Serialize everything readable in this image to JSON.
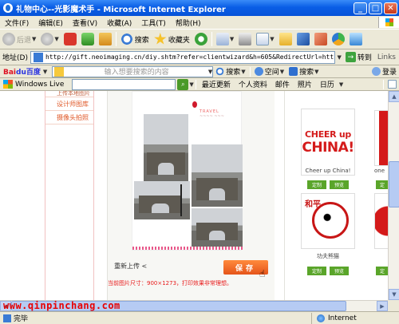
{
  "window": {
    "title": "礼物中心--光影魔术手 - Microsoft Internet Explorer",
    "minimize": "_",
    "maximize": "□",
    "close": "✕"
  },
  "menu": {
    "items": [
      "文件(F)",
      "编辑(E)",
      "查看(V)",
      "收藏(A)",
      "工具(T)",
      "帮助(H)"
    ]
  },
  "toolbar": {
    "back": "后退",
    "search": "搜索",
    "favorites": "收藏夹"
  },
  "address": {
    "label": "地址(D)",
    "url": "http://gift.neoimaging.cn/diy.shtm?refer=clientwizard&h=605&RedirectUrl=htt",
    "go": "转到",
    "links": "Links"
  },
  "baidu": {
    "logo_a": "Bai",
    "logo_b": "du百度",
    "placeholder": "输入想要搜索的内容",
    "search": "搜索",
    "space": "空间",
    "search2": "搜索",
    "login": "登录"
  },
  "live": {
    "logo": "Windows Live",
    "items": [
      "最近更新",
      "个人资料",
      "邮件",
      "照片",
      "日历"
    ]
  },
  "page": {
    "nav": [
      "上传本地图片",
      "设计师图库",
      "摄像头拍照"
    ],
    "card_text": "TRAVEL",
    "card_sub": "~~~~ ~~~",
    "reupload": "重新上传",
    "save": "保存",
    "size_info": "当前图片尺寸：900×1273，打印效果非常理想。",
    "designs": [
      {
        "line1": "CHEER up",
        "line2": "CHINA!",
        "caption": "Cheer up China!",
        "btn1": "定制",
        "btn2": "预览"
      },
      {
        "chars": "和平",
        "caption": "功夫熊猫",
        "btn1": "定制",
        "btn2": "预览"
      }
    ],
    "partial_caption": "one",
    "partial_btn": "定"
  },
  "status": {
    "text": "完毕",
    "zone": "Internet"
  },
  "watermark": "www.qinpinchang.com"
}
